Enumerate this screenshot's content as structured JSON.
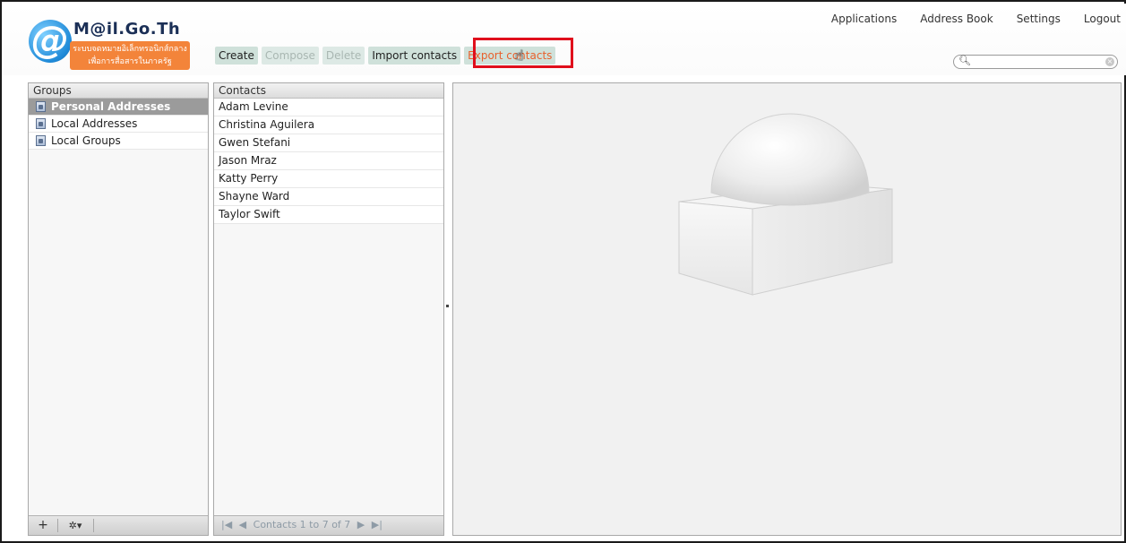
{
  "app": {
    "logo_symbol": "@",
    "logo_title": "M@il.Go.Th",
    "logo_subtitle_line1": "ระบบจดหมายอิเล็กทรอนิกส์กลาง",
    "logo_subtitle_line2": "เพื่อการสื่อสารในภาครัฐ"
  },
  "toplinks": [
    "Applications",
    "Address Book",
    "Settings",
    "Logout"
  ],
  "toolbar": {
    "create": "Create",
    "compose": "Compose",
    "delete": "Delete",
    "import": "Import contacts",
    "export": "Export contacts"
  },
  "search": {
    "placeholder": "",
    "value": ""
  },
  "groups": {
    "header": "Groups",
    "items": [
      {
        "label": "Personal Addresses",
        "selected": true
      },
      {
        "label": "Local Addresses",
        "selected": false
      },
      {
        "label": "Local Groups",
        "selected": false
      }
    ],
    "footer": {
      "add": "+",
      "settings": "✲▾"
    }
  },
  "contacts": {
    "header": "Contacts",
    "items": [
      "Adam Levine",
      "Christina Aguilera",
      "Gwen Stefani",
      "Jason Mraz",
      "Katty Perry",
      "Shayne Ward",
      "Taylor Swift"
    ],
    "pager": {
      "first": "|◀",
      "prev": "◀",
      "label": "Contacts 1 to 7 of 7",
      "next": "▶",
      "last": "▶|"
    }
  },
  "colors": {
    "accent_orange": "#f3843a",
    "highlight_red": "#e00f1c",
    "toolbar_bg": "#cfe1da",
    "selected_group": "#9b9b9b"
  },
  "icons": [
    "search-icon",
    "clear-icon",
    "address-book-icon",
    "add-icon",
    "gear-icon",
    "cursor-hand-icon"
  ]
}
